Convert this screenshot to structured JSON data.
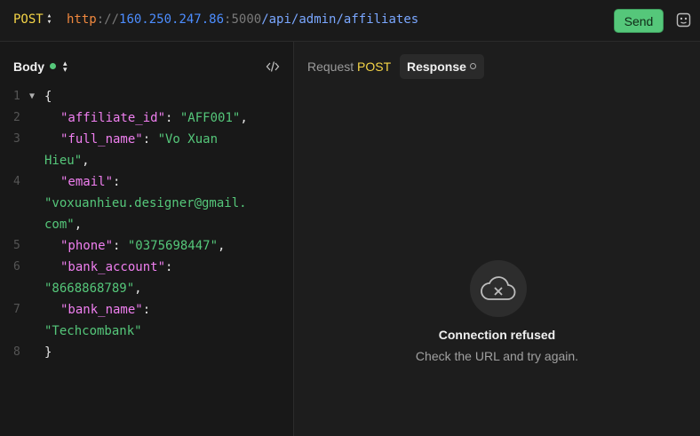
{
  "request": {
    "method": "POST",
    "url": {
      "scheme": "http",
      "separator": "://",
      "host": "160.250.247.86",
      "port": ":5000",
      "path": "/api/admin/affiliates"
    },
    "send_label": "Send"
  },
  "body_panel": {
    "label": "Body",
    "lines": [
      {
        "num": "1",
        "fold": "▼",
        "rows": [
          [
            {
              "t": "{",
              "c": "p"
            }
          ]
        ]
      },
      {
        "num": "2",
        "rows": [
          [
            {
              "t": "\"affiliate_id\"",
              "c": "k"
            },
            {
              "t": ": ",
              "c": "p"
            },
            {
              "t": "\"AFF001\"",
              "c": "s"
            },
            {
              "t": ",",
              "c": "p"
            }
          ]
        ]
      },
      {
        "num": "3",
        "rows": [
          [
            {
              "t": "\"full_name\"",
              "c": "k"
            },
            {
              "t": ": ",
              "c": "p"
            },
            {
              "t": "\"Vo Xuan",
              "c": "s"
            }
          ],
          [
            {
              "t": "Hieu\"",
              "c": "s"
            },
            {
              "t": ",",
              "c": "p"
            }
          ]
        ]
      },
      {
        "num": "4",
        "rows": [
          [
            {
              "t": "\"email\"",
              "c": "k"
            },
            {
              "t": ":",
              "c": "p"
            }
          ],
          [
            {
              "t": "\"voxuanhieu.designer@gmail.",
              "c": "s"
            }
          ],
          [
            {
              "t": "com\"",
              "c": "s"
            },
            {
              "t": ",",
              "c": "p"
            }
          ]
        ]
      },
      {
        "num": "5",
        "rows": [
          [
            {
              "t": "\"phone\"",
              "c": "k"
            },
            {
              "t": ": ",
              "c": "p"
            },
            {
              "t": "\"0375698447\"",
              "c": "s"
            },
            {
              "t": ",",
              "c": "p"
            }
          ]
        ]
      },
      {
        "num": "6",
        "rows": [
          [
            {
              "t": "\"bank_account\"",
              "c": "k"
            },
            {
              "t": ":",
              "c": "p"
            }
          ],
          [
            {
              "t": "\"8668868789\"",
              "c": "s"
            },
            {
              "t": ",",
              "c": "p"
            }
          ]
        ]
      },
      {
        "num": "7",
        "rows": [
          [
            {
              "t": "\"bank_name\"",
              "c": "k"
            },
            {
              "t": ":",
              "c": "p"
            }
          ],
          [
            {
              "t": "\"Techcombank\"",
              "c": "s"
            }
          ]
        ]
      },
      {
        "num": "8",
        "rows": [
          [
            {
              "t": "}",
              "c": "p"
            }
          ]
        ]
      }
    ]
  },
  "tabs": {
    "request_label": "Request",
    "request_method": "POST",
    "response_label": "Response"
  },
  "response": {
    "icon": "cloud-x-icon",
    "title": "Connection refused",
    "subtitle": "Check the URL and try again."
  },
  "colors": {
    "method": "#f5d547",
    "send": "#55c77a",
    "json_key": "#f07ff0",
    "json_string": "#55c77a"
  }
}
